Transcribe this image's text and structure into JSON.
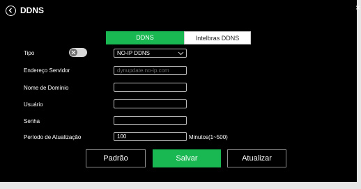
{
  "header": {
    "title": "DDNS",
    "close_glyph": "×"
  },
  "tabs": [
    {
      "label": "DDNS",
      "active": true
    },
    {
      "label": "Intelbras DDNS",
      "active": false
    }
  ],
  "form": {
    "tipo": {
      "label": "Tipo",
      "enabled": false,
      "selected": "NO-IP DDNS"
    },
    "server": {
      "label": "Endereço Servidor",
      "placeholder": "dynupdate.no-ip.com",
      "value": ""
    },
    "domain": {
      "label": "Nome de Domínio",
      "value": ""
    },
    "user": {
      "label": "Usuário",
      "value": ""
    },
    "password": {
      "label": "Senha",
      "value": ""
    },
    "period": {
      "label": "Período de Atualização",
      "value": "100",
      "unit": "Minutos(1~500)"
    }
  },
  "buttons": {
    "default": "Padrão",
    "save": "Salvar",
    "refresh": "Atualizar"
  },
  "colors": {
    "accent": "#19b853",
    "background": "#000000"
  },
  "icons": {
    "back": "back-arrow-icon",
    "close": "close-icon",
    "dropdown": "chevron-down-icon",
    "toggle": "x-icon"
  }
}
